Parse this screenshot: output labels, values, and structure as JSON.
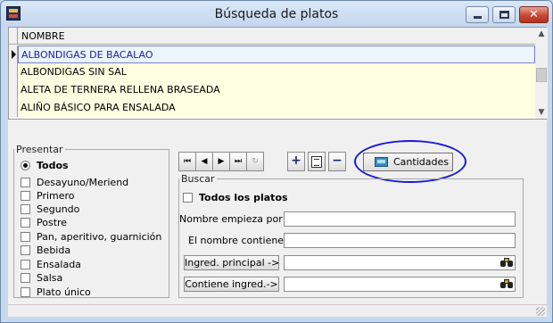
{
  "window": {
    "title": "Búsqueda de platos",
    "controls": {
      "minimize": "minimize",
      "maximize": "maximize",
      "close": "✕"
    }
  },
  "grid": {
    "column_header": "NOMBRE",
    "rows": [
      "ALBONDIGAS DE BACALAO",
      "ALBONDIGAS SIN SAL",
      "ALETA DE TERNERA RELLENA BRASEADA",
      "ALIÑO BÁSICO PARA ENSALADA"
    ],
    "selected_row": 0
  },
  "presentar": {
    "legend": "Presentar",
    "radio_all": "Todos",
    "options": [
      "Desayuno/Meriend",
      "Primero",
      "Segundo",
      "Postre",
      "Pan, aperitivo, guarnición",
      "Bebida",
      "Ensalada",
      "Salsa",
      "Plato único"
    ]
  },
  "navigator": {
    "first": "⏮",
    "prev": "◀",
    "next": "▶",
    "last": "⏭",
    "refresh": "↻"
  },
  "actions": {
    "add": "+",
    "remove": "−",
    "cantidades_label": "Cantidades"
  },
  "buscar": {
    "legend": "Buscar",
    "todos_platos": "Todos los platos",
    "nombre_empieza_por": "Nombre empieza por",
    "nombre_contiene": "El nombre contiene",
    "ingred_principal": "Ingred. principal ->",
    "contiene_ingred": "Contiene ingred.->",
    "values": {
      "nombre_empieza_por": "",
      "nombre_contiene": "",
      "ingred_principal": "",
      "contiene_ingred": ""
    }
  },
  "icons": {
    "app": "app-icon",
    "binoculars": "binoculars-icon",
    "cantidades": "cantidades-icon",
    "edit": "edit-document-icon"
  },
  "colors": {
    "selected_row_text": "#1a1aa0",
    "row_background": "#ffffe1",
    "highlight_ring": "#1a1ad6"
  }
}
